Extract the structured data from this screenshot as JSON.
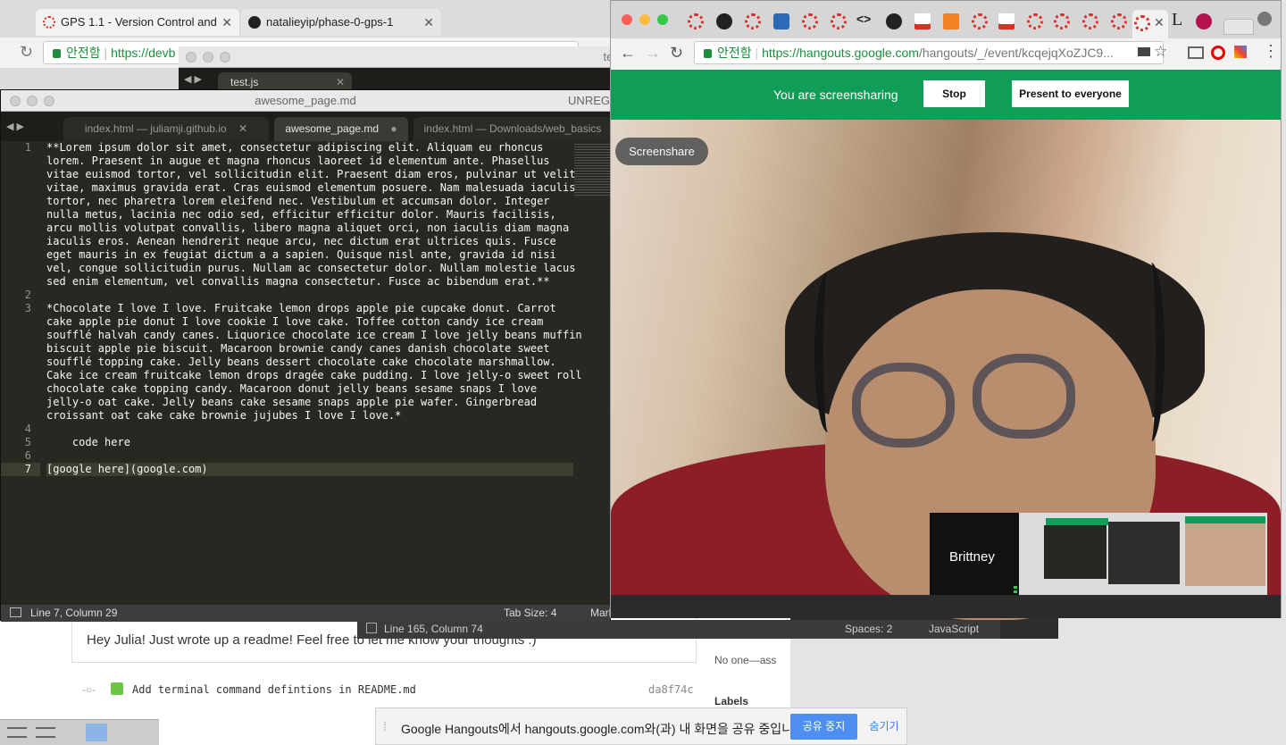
{
  "back_chrome": {
    "tabs": [
      {
        "title": "GPS 1.1 - Version Control and"
      },
      {
        "title": "natalieyip/phase-0-gps-1"
      }
    ],
    "secure_label": "안전함",
    "url": "https://devb"
  },
  "sublime_back": {
    "title": "test.js",
    "tab": "test.js",
    "status": {
      "position": "Line 165, Column 74",
      "spaces": "Spaces: 2",
      "syntax": "JavaScript"
    }
  },
  "sublime": {
    "title": "awesome_page.md",
    "title_right": "UNREG",
    "tabs": [
      {
        "label": "index.html — juliamji.github.io"
      },
      {
        "label": "awesome_page.md"
      },
      {
        "label": "index.html — Downloads/web_basics"
      }
    ],
    "lines": [
      {
        "num": "1",
        "text": "**Lorem ipsum dolor sit amet, consectetur adipiscing elit. Aliquam eu rhoncus"
      },
      {
        "num": "",
        "text": "lorem. Praesent in augue et magna rhoncus laoreet id elementum ante. Phasellus"
      },
      {
        "num": "",
        "text": "vitae euismod tortor, vel sollicitudin elit. Praesent diam eros, pulvinar ut velit"
      },
      {
        "num": "",
        "text": "vitae, maximus gravida erat. Cras euismod elementum posuere. Nam malesuada iaculis"
      },
      {
        "num": "",
        "text": "tortor, nec pharetra lorem eleifend nec. Vestibulum et accumsan dolor. Integer"
      },
      {
        "num": "",
        "text": "nulla metus, lacinia nec odio sed, efficitur efficitur dolor. Mauris facilisis,"
      },
      {
        "num": "",
        "text": "arcu mollis volutpat convallis, libero magna aliquet orci, non iaculis diam magna"
      },
      {
        "num": "",
        "text": "iaculis eros. Aenean hendrerit neque arcu, nec dictum erat ultrices quis. Fusce"
      },
      {
        "num": "",
        "text": "eget mauris in ex feugiat dictum a a sapien. Quisque nisl ante, gravida id nisi"
      },
      {
        "num": "",
        "text": "vel, congue sollicitudin purus. Nullam ac consectetur dolor. Nullam molestie lacus"
      },
      {
        "num": "",
        "text": "sed enim elementum, vel convallis magna consectetur. Fusce ac bibendum erat.**"
      },
      {
        "num": "2",
        "text": ""
      },
      {
        "num": "3",
        "text": "*Chocolate I love I love. Fruitcake lemon drops apple pie cupcake donut. Carrot"
      },
      {
        "num": "",
        "text": "cake apple pie donut I love cookie I love cake. Toffee cotton candy ice cream"
      },
      {
        "num": "",
        "text": "soufflé halvah candy canes. Liquorice chocolate ice cream I love jelly beans muffin"
      },
      {
        "num": "",
        "text": "biscuit apple pie biscuit. Macaroon brownie candy canes danish chocolate sweet"
      },
      {
        "num": "",
        "text": "soufflé topping cake. Jelly beans dessert chocolate cake chocolate marshmallow."
      },
      {
        "num": "",
        "text": "Cake ice cream fruitcake lemon drops dragée cake pudding. I love jelly-o sweet roll"
      },
      {
        "num": "",
        "text": "chocolate cake topping candy. Macaroon donut jelly beans sesame snaps I love"
      },
      {
        "num": "",
        "text": "jelly-o oat cake. Jelly beans cake sesame snaps apple pie wafer. Gingerbread"
      },
      {
        "num": "",
        "text": "croissant oat cake cake brownie jujubes I love I love.*"
      },
      {
        "num": "4",
        "text": ""
      },
      {
        "num": "5",
        "text": "    code here"
      },
      {
        "num": "6",
        "text": ""
      },
      {
        "num": "7",
        "text": "[google here](google.com)"
      }
    ],
    "status": {
      "position": "Line 7, Column 29",
      "tab_size": "Tab Size: 4",
      "syntax": "Mark"
    }
  },
  "github": {
    "comment": "Hey Julia! Just wrote up a readme! Feel free to let me know your thoughts :)",
    "commit_message": "Add terminal command defintions in README.md",
    "commit_sha": "da8f74c",
    "assignees": "No one—ass",
    "labels_heading": "Labels"
  },
  "hangouts": {
    "secure_label": "안전함",
    "url_host": "https://hangouts.google.com",
    "url_path": "/hangouts/_/event/kcqejqXoZJC9...",
    "banner_text": "You are screensharing",
    "stop_label": "Stop",
    "present_label": "Present to everyone",
    "screenshare_chip": "Screenshare",
    "participant": "Brittney",
    "tab_L": "L"
  },
  "notification": {
    "text": "Google Hangouts에서 hangouts.google.com와(과) 내 화면을 공유 중입니다.",
    "stop_label": "공유 중지",
    "hide_label": "숨기기"
  }
}
